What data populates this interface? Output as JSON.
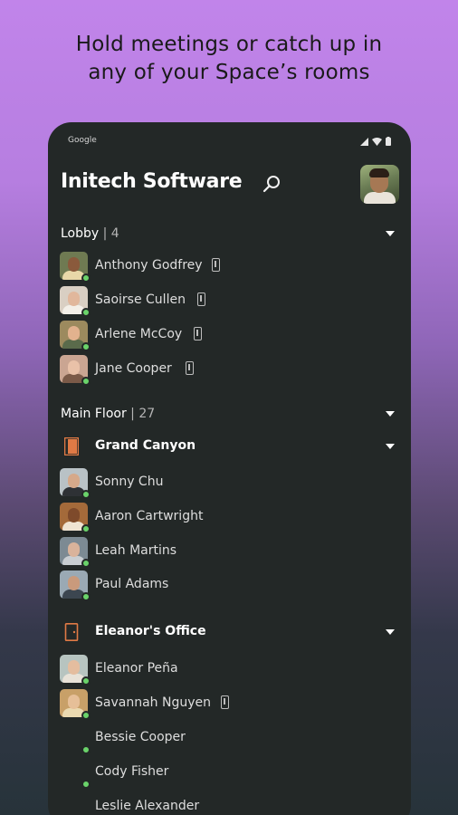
{
  "headline": {
    "line1": "Hold meetings or catch up in",
    "line2": "any of your Space’s rooms"
  },
  "status_bar": {
    "carrier": "Google",
    "icons": [
      "signal-icon",
      "wifi-icon",
      "battery-icon"
    ]
  },
  "header": {
    "title": "Initech Software",
    "search_icon": "search-icon",
    "profile_icon": "avatar"
  },
  "colors": {
    "online": "#6ad36a",
    "room_icon": "#e07a45",
    "panel": "#232827"
  },
  "lobby": {
    "name": "Lobby",
    "count": "| 4",
    "people": [
      {
        "name": "Anthony Godfrey",
        "mobile": true
      },
      {
        "name": "Saoirse Cullen",
        "mobile": true
      },
      {
        "name": "Arlene McCoy",
        "mobile": true
      },
      {
        "name": "Jane Cooper",
        "mobile": true
      }
    ]
  },
  "main_floor": {
    "name": "Main Floor",
    "count": "| 27",
    "rooms": [
      {
        "name": "Grand Canyon",
        "people": [
          {
            "name": "Sonny Chu",
            "mobile": false
          },
          {
            "name": "Aaron Cartwright",
            "mobile": false
          },
          {
            "name": "Leah Martins",
            "mobile": false
          },
          {
            "name": "Paul Adams",
            "mobile": false
          }
        ]
      },
      {
        "name": "Eleanor's Office",
        "people": [
          {
            "name": "Eleanor Peña",
            "mobile": false
          },
          {
            "name": "Savannah Nguyen",
            "mobile": true
          },
          {
            "name": "Bessie Cooper",
            "mobile": false
          },
          {
            "name": "Cody Fisher",
            "mobile": false
          },
          {
            "name": "Leslie Alexander",
            "mobile": false
          }
        ]
      }
    ]
  }
}
